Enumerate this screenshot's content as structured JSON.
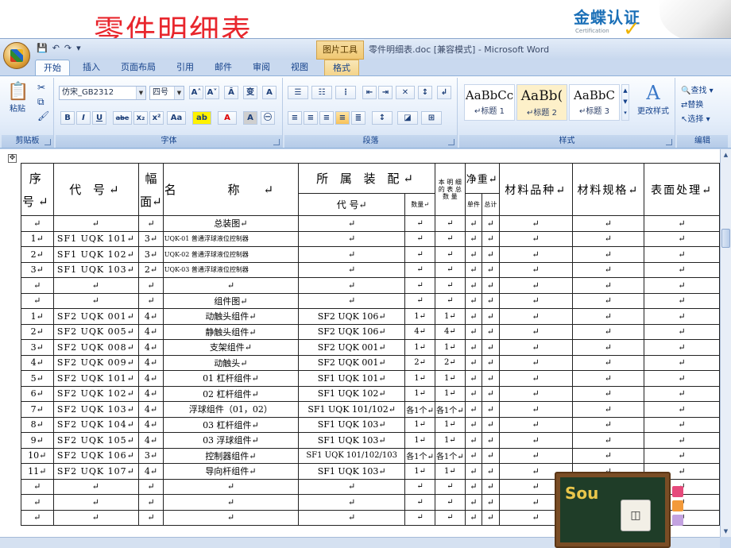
{
  "slide": {
    "title": "零件明细表",
    "logo_text": "金蝶认证",
    "logo_sub": "Certification"
  },
  "word": {
    "quick_access": [
      "💾",
      "↶",
      "↷",
      "▾"
    ],
    "contextual_tab_group": "图片工具",
    "window_title": "零件明细表.doc [兼容模式] - Microsoft Word",
    "tabs": [
      "开始",
      "插入",
      "页面布局",
      "引用",
      "邮件",
      "审阅",
      "视图",
      "格式"
    ],
    "ribbon": {
      "clipboard": {
        "paste": "粘贴",
        "label": "剪贴板"
      },
      "font": {
        "name": "仿宋_GB2312",
        "size": "四号",
        "label": "字体",
        "b": "B",
        "i": "I",
        "u": "U",
        "strike": "abe",
        "sub": "x₂",
        "sup": "x²",
        "case": "Aa",
        "grow": "A˄",
        "shrink": "A˅",
        "clear": "Ā",
        "pinyin": "变",
        "border": "A"
      },
      "paragraph": {
        "label": "段落"
      },
      "styles": {
        "label": "样式",
        "items": [
          {
            "sample": "AaBbCc",
            "name": "↵标题 1"
          },
          {
            "sample": "AaBb(",
            "name": "↵标题 2"
          },
          {
            "sample": "AaBbC",
            "name": "↵标题 3"
          }
        ],
        "change": "更改样式"
      },
      "editing": {
        "label": "编辑",
        "find": "查找 ▾",
        "replace": "替换",
        "select": "选择 ▾"
      }
    }
  },
  "table": {
    "headers": {
      "seq_top": "序",
      "seq_bot": "号↵",
      "code": "代  号↵",
      "sheet_top": "幅",
      "sheet_bot": "面↵",
      "name": "名  称↵",
      "assembly": "所 属 装 配↵",
      "asm_code": "代 号↵",
      "asm_qty": "数量↵",
      "total": "本 明 细 的 表 总 数 量",
      "weight": "净重↵",
      "weight_single": "单件",
      "weight_total": "总计",
      "material": "材料品种↵",
      "spec": "材料规格↵",
      "surface": "表面处理↵"
    },
    "rows": [
      {
        "seq": "↵",
        "code": "↵",
        "sheet": "↵",
        "name": "总装图↵",
        "asm_code": "↵",
        "asm_qty": "↵",
        "total": "↵",
        "w1": "↵",
        "w2": "↵",
        "mat": "↵",
        "spec": "↵",
        "surf": "↵"
      },
      {
        "seq": "1↵",
        "code": "SF1 UQK 101↵",
        "sheet": "3↵",
        "name": "UQK-01 普通浮球液位控制器",
        "asm_code": "↵",
        "asm_qty": "↵",
        "total": "↵",
        "w1": "↵",
        "w2": "↵",
        "mat": "↵",
        "spec": "↵",
        "surf": "↵"
      },
      {
        "seq": "2↵",
        "code": "SF1 UQK 102↵",
        "sheet": "3↵",
        "name": "UQK-02 普通浮球液位控制器",
        "asm_code": "↵",
        "asm_qty": "↵",
        "total": "↵",
        "w1": "↵",
        "w2": "↵",
        "mat": "↵",
        "spec": "↵",
        "surf": "↵"
      },
      {
        "seq": "3↵",
        "code": "SF1 UQK 103↵",
        "sheet": "2↵",
        "name": "UQK-03 普通浮球液位控制器",
        "asm_code": "↵",
        "asm_qty": "↵",
        "total": "↵",
        "w1": "↵",
        "w2": "↵",
        "mat": "↵",
        "spec": "↵",
        "surf": "↵"
      },
      {
        "seq": "↵",
        "code": "↵",
        "sheet": "↵",
        "name": "↵",
        "asm_code": "↵",
        "asm_qty": "↵",
        "total": "↵",
        "w1": "↵",
        "w2": "↵",
        "mat": "↵",
        "spec": "↵",
        "surf": "↵"
      },
      {
        "seq": "↵",
        "code": "↵",
        "sheet": "↵",
        "name": "组件图↵",
        "asm_code": "↵",
        "asm_qty": "↵",
        "total": "↵",
        "w1": "↵",
        "w2": "↵",
        "mat": "↵",
        "spec": "↵",
        "surf": "↵"
      },
      {
        "seq": "1↵",
        "code": "SF2 UQK 001↵",
        "sheet": "4↵",
        "name": "动触头组件↵",
        "asm_code": "SF2 UQK 106↵",
        "asm_qty": "1↵",
        "total": "1↵",
        "w1": "↵",
        "w2": "↵",
        "mat": "↵",
        "spec": "↵",
        "surf": "↵"
      },
      {
        "seq": "2↵",
        "code": "SF2 UQK 005↵",
        "sheet": "4↵",
        "name": "静触头组件↵",
        "asm_code": "SF2 UQK 106↵",
        "asm_qty": "4↵",
        "total": "4↵",
        "w1": "↵",
        "w2": "↵",
        "mat": "↵",
        "spec": "↵",
        "surf": "↵"
      },
      {
        "seq": "3↵",
        "code": "SF2 UQK 008↵",
        "sheet": "4↵",
        "name": "支架组件↵",
        "asm_code": "SF2 UQK 001↵",
        "asm_qty": "1↵",
        "total": "1↵",
        "w1": "↵",
        "w2": "↵",
        "mat": "↵",
        "spec": "↵",
        "surf": "↵"
      },
      {
        "seq": "4↵",
        "code": "SF2 UQK 009↵",
        "sheet": "4↵",
        "name": "动触头↵",
        "asm_code": "SF2 UQK 001↵",
        "asm_qty": "2↵",
        "total": "2↵",
        "w1": "↵",
        "w2": "↵",
        "mat": "↵",
        "spec": "↵",
        "surf": "↵"
      },
      {
        "seq": "5↵",
        "code": "SF2 UQK 101↵",
        "sheet": "4↵",
        "name": "01 杠杆组件↵",
        "asm_code": "SF1 UQK 101↵",
        "asm_qty": "1↵",
        "total": "1↵",
        "w1": "↵",
        "w2": "↵",
        "mat": "↵",
        "spec": "↵",
        "surf": "↵"
      },
      {
        "seq": "6↵",
        "code": "SF2 UQK 102↵",
        "sheet": "4↵",
        "name": "02 杠杆组件↵",
        "asm_code": "SF1 UQK 102↵",
        "asm_qty": "1↵",
        "total": "1↵",
        "w1": "↵",
        "w2": "↵",
        "mat": "↵",
        "spec": "↵",
        "surf": "↵"
      },
      {
        "seq": "7↵",
        "code": "SF2 UQK 103↵",
        "sheet": "4↵",
        "name": "浮球组件（01，02）",
        "asm_code": "SF1 UQK 101/102↵",
        "asm_qty": "各1个↵",
        "total": "各1个↵",
        "w1": "↵",
        "w2": "↵",
        "mat": "↵",
        "spec": "↵",
        "surf": "↵"
      },
      {
        "seq": "8↵",
        "code": "SF2 UQK 104↵",
        "sheet": "4↵",
        "name": "03 杠杆组件↵",
        "asm_code": "SF1 UQK 103↵",
        "asm_qty": "1↵",
        "total": "1↵",
        "w1": "↵",
        "w2": "↵",
        "mat": "↵",
        "spec": "↵",
        "surf": "↵"
      },
      {
        "seq": "9↵",
        "code": "SF2 UQK 105↵",
        "sheet": "4↵",
        "name": "03 浮球组件↵",
        "asm_code": "SF1 UQK 103↵",
        "asm_qty": "1↵",
        "total": "1↵",
        "w1": "↵",
        "w2": "↵",
        "mat": "↵",
        "spec": "↵",
        "surf": "↵"
      },
      {
        "seq": "10↵",
        "code": "SF2 UQK 106↵",
        "sheet": "3↵",
        "name": "控制器组件↵",
        "asm_code": "SF1 UQK 101/102/103",
        "asm_qty": "各1个↵",
        "total": "各1个↵",
        "w1": "↵",
        "w2": "↵",
        "mat": "↵",
        "spec": "↵",
        "surf": "↵"
      },
      {
        "seq": "11↵",
        "code": "SF2 UQK 107↵",
        "sheet": "4↵",
        "name": "导向杆组件↵",
        "asm_code": "SF1 UQK 103↵",
        "asm_qty": "1↵",
        "total": "1↵",
        "w1": "↵",
        "w2": "↵",
        "mat": "↵",
        "spec": "↵",
        "surf": "↵"
      },
      {
        "seq": "↵",
        "code": "↵",
        "sheet": "↵",
        "name": "↵",
        "asm_code": "↵",
        "asm_qty": "↵",
        "total": "↵",
        "w1": "↵",
        "w2": "↵",
        "mat": "↵",
        "spec": "↵",
        "surf": "↵"
      },
      {
        "seq": "↵",
        "code": "↵",
        "sheet": "↵",
        "name": "↵",
        "asm_code": "↵",
        "asm_qty": "↵",
        "total": "↵",
        "w1": "↵",
        "w2": "↵",
        "mat": "↵",
        "spec": "↵",
        "surf": "↵"
      },
      {
        "seq": "↵",
        "code": "↵",
        "sheet": "↵",
        "name": "↵",
        "asm_code": "↵",
        "asm_qty": "↵",
        "total": "↵",
        "w1": "↵",
        "w2": "↵",
        "mat": "↵",
        "spec": "↵",
        "surf": "↵"
      }
    ]
  },
  "board": {
    "emblem": "Sou",
    "robot": "◫"
  },
  "colors": {
    "title_red": "#e8262d",
    "logo_blue": "#1a6fb7",
    "ribbon_text": "#15428b"
  }
}
